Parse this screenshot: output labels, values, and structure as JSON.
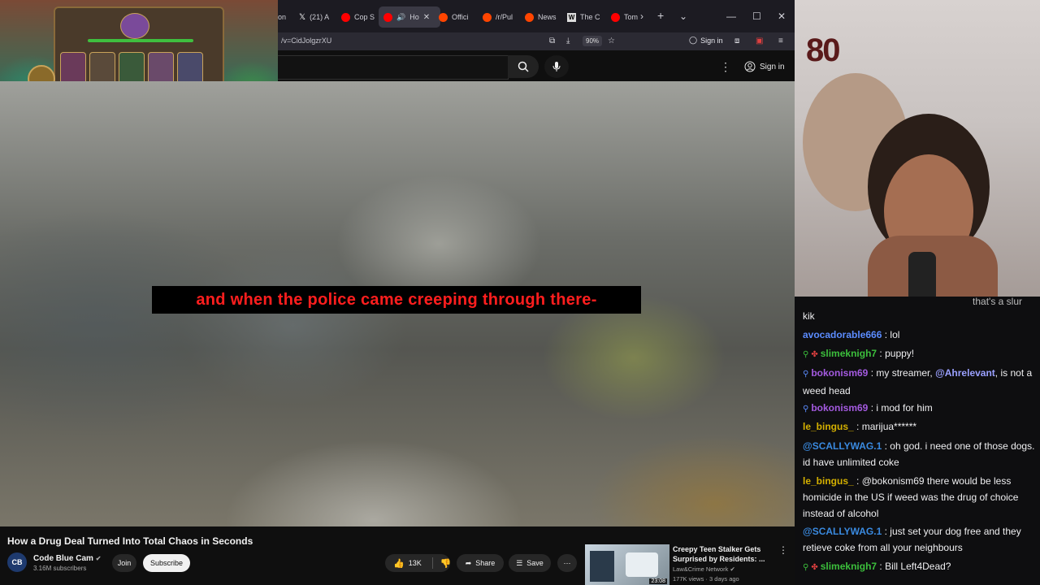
{
  "browser": {
    "tabs": [
      {
        "label": "on",
        "color": "#888888"
      },
      {
        "label": "(21) A",
        "color": "#ffffff",
        "icon": "x-logo"
      },
      {
        "label": "Cop S",
        "color": "#ff0000"
      },
      {
        "label": "Ho",
        "color": "#ff0000",
        "active": true
      },
      {
        "label": "Offici",
        "color": "#ff4500"
      },
      {
        "label": "/r/Pul",
        "color": "#ff4500"
      },
      {
        "label": "News",
        "color": "#ff4500"
      },
      {
        "label": "The C",
        "color": "#dddddd",
        "icon": "wikipedia-logo"
      },
      {
        "label": "Tom",
        "color": "#ff0000"
      }
    ],
    "url": "/v=CidJolgzrXU",
    "zoom": "90%",
    "sign_in": "Sign in"
  },
  "youtube": {
    "header_sign_in": "Sign in",
    "subtitle": "and when the police came creeping through there-",
    "video_title": "How a Drug Deal Turned Into Total Chaos in Seconds",
    "channel": {
      "name": "Code Blue Cam",
      "subscribers": "3.16M subscribers",
      "avatar_text": "CB"
    },
    "buttons": {
      "join": "Join",
      "subscribe": "Subscribe",
      "likes": "13K",
      "share": "Share",
      "save": "Save"
    },
    "recommended": {
      "title": "Creepy Teen Stalker Gets Surprised by Residents: ...",
      "channel": "Law&Crime Network",
      "meta": "177K views · 3 days ago",
      "duration": "23:08"
    }
  },
  "webcam": {
    "background_text": "80"
  },
  "chat": {
    "messages": [
      {
        "user": "",
        "text": "kik",
        "color": "#efeff1",
        "badges": []
      },
      {
        "user": "avocadorable666",
        "text": "lol",
        "color": "#5b8cff",
        "badges": []
      },
      {
        "user": "slimeknigh7",
        "text": "puppy!",
        "color": "#3cbf3c",
        "badges": [
          "person",
          "mod"
        ]
      },
      {
        "user": "bokonism69",
        "text": "my streamer, @Ahrelevant, is not a weed head",
        "mention": "@Ahrelevant",
        "color": "#a45ae0",
        "badges": [
          "person"
        ]
      },
      {
        "user": "bokonism69",
        "text": "i mod for him",
        "color": "#a45ae0",
        "badges": []
      },
      {
        "user": "le_bingus_",
        "text": "marijua******",
        "color": "#d4b000",
        "badges": []
      },
      {
        "user": "@SCALLYWAG.1",
        "text": "oh god. i need one of those dogs. id have unlimited coke",
        "color": "#3a8ae0",
        "badges": []
      },
      {
        "user": "le_bingus_",
        "text": "@bokonism69 there would be less homicide in the US if weed was the drug of choice instead of alcohol",
        "color": "#d4b000",
        "badges": []
      },
      {
        "user": "@SCALLYWAG.1",
        "text": "just set your dog free and they retieve coke from all your neighbours",
        "color": "#3a8ae0",
        "badges": []
      },
      {
        "user": "slimeknigh7",
        "text": "Bill Left4Dead?",
        "color": "#3cbf3c",
        "badges": [
          "person",
          "mod"
        ]
      }
    ],
    "partial_top": "that's a slur"
  }
}
